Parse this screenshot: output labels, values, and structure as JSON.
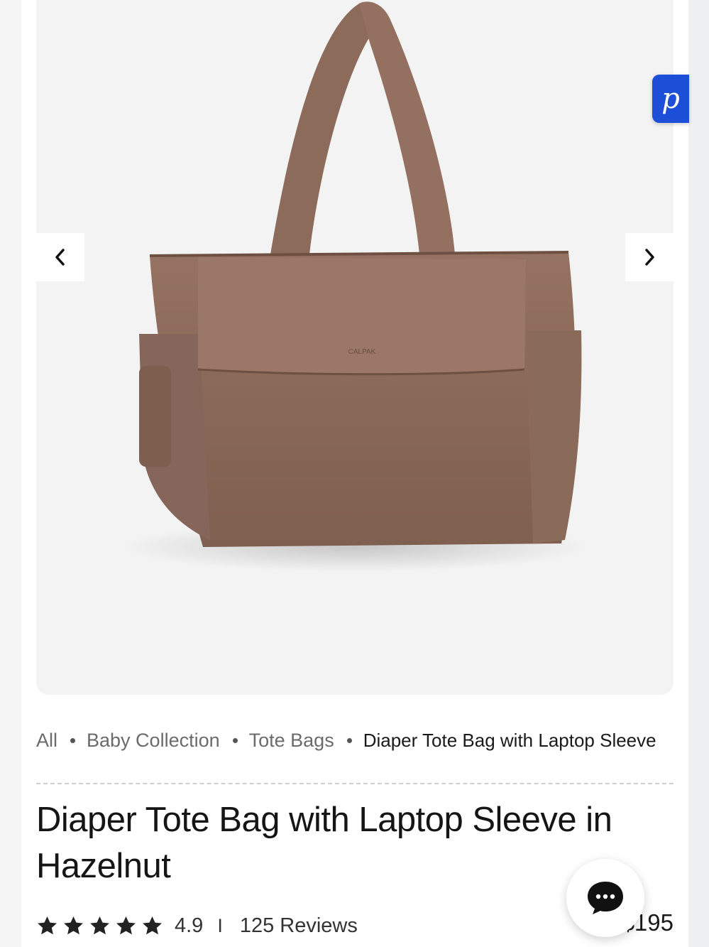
{
  "gallery": {
    "brand_mark": "CALPAK",
    "prev_icon": "chevron-left-icon",
    "next_icon": "chevron-right-icon"
  },
  "badge": {
    "letter": "p"
  },
  "breadcrumb": {
    "items": [
      "All",
      "Baby Collection",
      "Tote Bags"
    ],
    "current": "Diaper Tote Bag with Laptop Sleeve"
  },
  "product": {
    "title": "Diaper Tote Bag with Laptop Sleeve in Hazelnut",
    "rating": "4.9",
    "separator": "I",
    "reviews": "125 Reviews",
    "stars": 5,
    "price": "$195"
  },
  "chat": {
    "icon": "chat-bubble-icon"
  },
  "colors": {
    "bag": "#8b6a58",
    "badge": "#1d4ed8",
    "accent": "#151515"
  }
}
